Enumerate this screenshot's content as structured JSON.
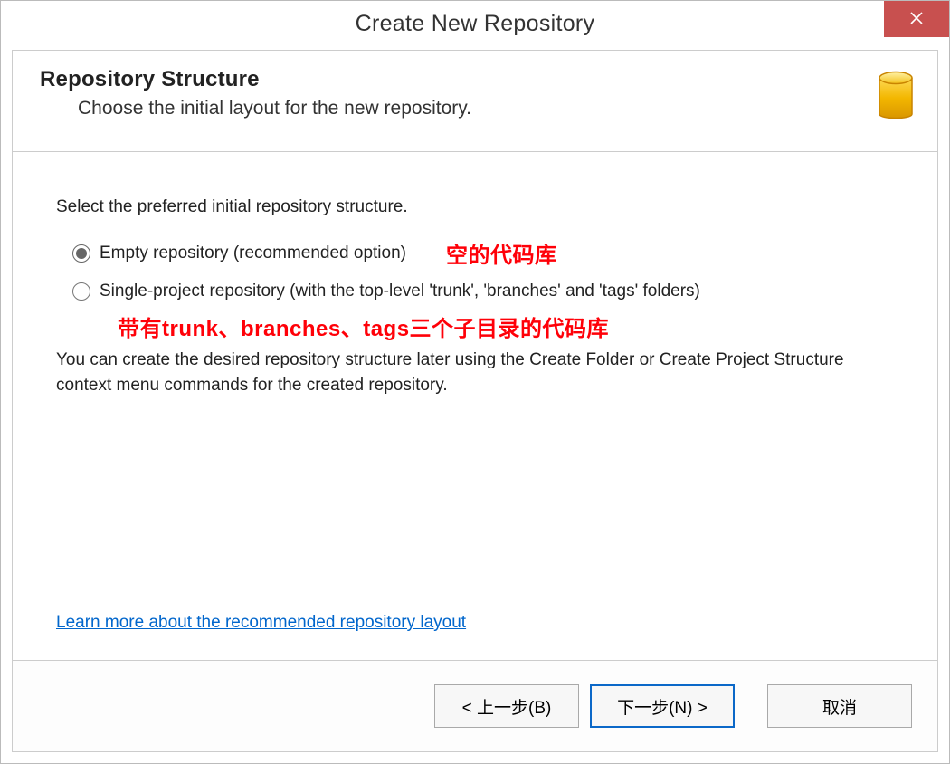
{
  "window": {
    "title": "Create New Repository"
  },
  "header": {
    "heading": "Repository Structure",
    "subtitle": "Choose the initial layout for the new repository."
  },
  "body": {
    "intro": "Select the preferred initial repository structure.",
    "option_empty_label": "Empty repository (recommended option)",
    "option_empty_annotation": "空的代码库",
    "option_single_label": "Single-project repository (with the top-level 'trunk', 'branches' and 'tags' folders)",
    "option_single_annotation": "带有trunk、branches、tags三个子目录的代码库",
    "selected": "empty",
    "note": "You can create the desired repository structure later using the Create Folder or Create Project Structure context menu commands for the created repository.",
    "learn_link": "Learn more about the recommended repository layout"
  },
  "footer": {
    "back_label": "< 上一步(B)",
    "next_label": "下一步(N) >",
    "cancel_label": "取消"
  }
}
